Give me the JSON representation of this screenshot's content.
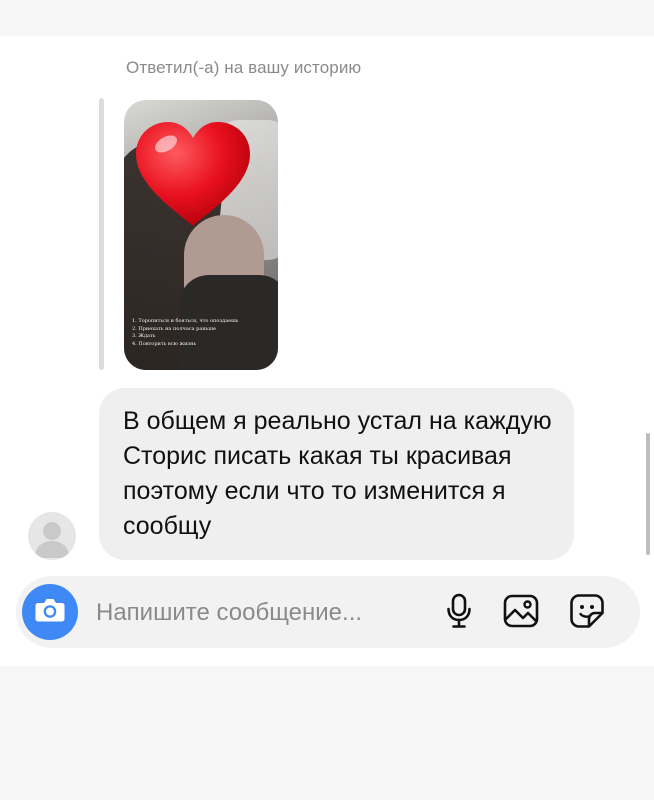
{
  "reply": {
    "label": "Ответил(-а) на вашу историю",
    "story_lines": [
      "1. Торопиться и бояться, что опоздаешь",
      "2. Приехать на полчаса раньше",
      "3. Ждать",
      "4. Повторить всю жизнь"
    ]
  },
  "message": {
    "text": "В общем я реально устал на каждую Сторис писать какая ты красивая поэтому если что то изменится я сообщу"
  },
  "composer": {
    "placeholder": "Напишите сообщение..."
  },
  "icons": {
    "camera": "camera-icon",
    "microphone": "microphone-icon",
    "gallery": "gallery-icon",
    "sticker": "sticker-icon",
    "heart": "heart-icon",
    "avatar": "avatar-icon"
  },
  "colors": {
    "accent": "#3f89f7",
    "bubble": "#efefef",
    "heart": "#e8101e"
  }
}
